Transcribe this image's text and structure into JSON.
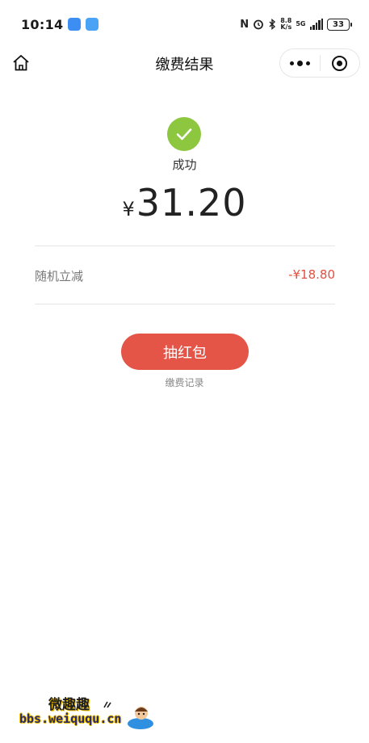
{
  "status_bar": {
    "time": "10:14",
    "nfc_glyph": "N",
    "speed_value": "8.8",
    "speed_unit": "K/s",
    "network": "5G",
    "battery": "33"
  },
  "nav": {
    "title": "缴费结果"
  },
  "result": {
    "status_text": "成功",
    "currency": "¥",
    "amount": "31.20"
  },
  "discount": {
    "label": "随机立减",
    "value": "-¥18.80"
  },
  "actions": {
    "red_packet_label": "抽红包",
    "records_label": "缴费记录"
  },
  "watermark": {
    "line1": "微趣趣",
    "line2": "bbs.weiququ.cn"
  },
  "colors": {
    "success_green": "#8dc63f",
    "accent_red": "#e45548",
    "discount_red": "#e2503f"
  },
  "icons": {
    "home": "home-icon",
    "more": "more-dots-icon",
    "close": "target-circle-icon",
    "success": "check-circle-icon"
  }
}
